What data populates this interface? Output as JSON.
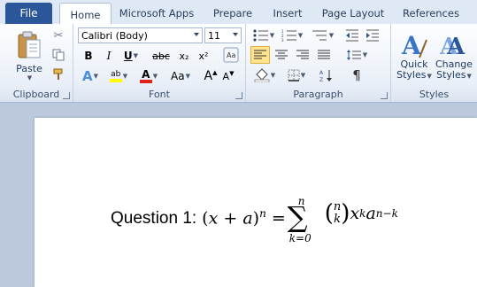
{
  "tabs": {
    "file": "File",
    "home": "Home",
    "microsoft_apps": "Microsoft Apps",
    "prepare": "Prepare",
    "insert": "Insert",
    "page_layout": "Page Layout",
    "references": "References"
  },
  "clipboard": {
    "label": "Clipboard",
    "paste": "Paste"
  },
  "font": {
    "label": "Font",
    "name": "Calibri (Body)",
    "size": "11",
    "bold": "B",
    "italic": "I",
    "underline": "U",
    "strike": "abc",
    "subscript": "x₂",
    "superscript": "x²",
    "grow": "A",
    "shrink": "A",
    "change_case": "Aa",
    "highlight": "ab",
    "font_color": "A"
  },
  "paragraph": {
    "label": "Paragraph"
  },
  "styles": {
    "label": "Styles",
    "quick_styles_1": "Quick",
    "quick_styles_2": "Styles",
    "change_styles_1": "Change",
    "change_styles_2": "Styles"
  },
  "document": {
    "question_label": "Question 1:",
    "equation": {
      "lhs_x": "x",
      "lhs_plus": " + ",
      "lhs_a": "a",
      "lhs_exp": "n",
      "eq": " = ",
      "sum": "∑",
      "sum_upper": "n",
      "sum_lower": "k=0",
      "binom_top": "n",
      "binom_bottom": "k",
      "term_x": "x",
      "term_x_exp": "k",
      "term_a": "a",
      "term_a_exp": "n−k"
    }
  },
  "colors": {
    "file_tab": "#2b579a",
    "highlight_yellow": "#ffff00",
    "font_red": "#e0201b",
    "accent_blue": "#2b579a"
  }
}
